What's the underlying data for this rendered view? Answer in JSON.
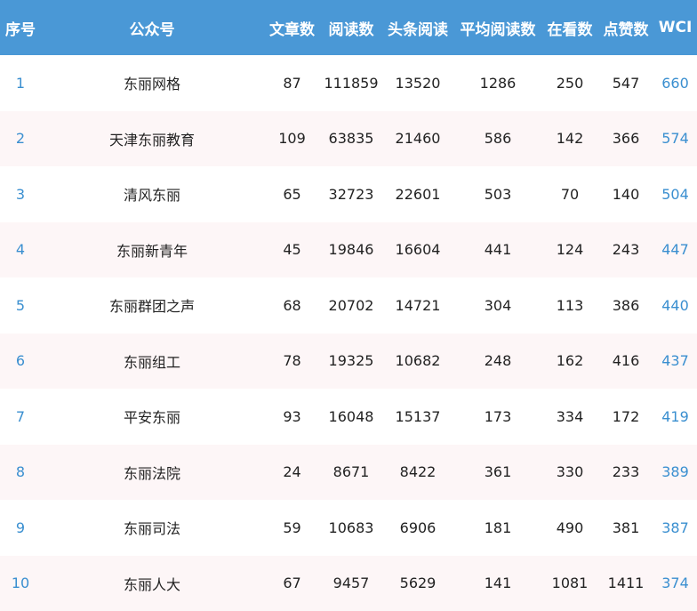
{
  "header": {
    "idx": "序号",
    "name": "公众号",
    "articles": "文章数",
    "reads": "阅读数",
    "headline_reads": "头条阅读",
    "avg_reads": "平均阅读数",
    "watching": "在看数",
    "likes": "点赞数",
    "wci": "WCI"
  },
  "rows": [
    {
      "idx": "1",
      "name": "东丽网格",
      "articles": "87",
      "reads": "111859",
      "headline_reads": "13520",
      "avg_reads": "1286",
      "watching": "250",
      "likes": "547",
      "wci": "660"
    },
    {
      "idx": "2",
      "name": "天津东丽教育",
      "articles": "109",
      "reads": "63835",
      "headline_reads": "21460",
      "avg_reads": "586",
      "watching": "142",
      "likes": "366",
      "wci": "574"
    },
    {
      "idx": "3",
      "name": "清风东丽",
      "articles": "65",
      "reads": "32723",
      "headline_reads": "22601",
      "avg_reads": "503",
      "watching": "70",
      "likes": "140",
      "wci": "504"
    },
    {
      "idx": "4",
      "name": "东丽新青年",
      "articles": "45",
      "reads": "19846",
      "headline_reads": "16604",
      "avg_reads": "441",
      "watching": "124",
      "likes": "243",
      "wci": "447"
    },
    {
      "idx": "5",
      "name": "东丽群团之声",
      "articles": "68",
      "reads": "20702",
      "headline_reads": "14721",
      "avg_reads": "304",
      "watching": "113",
      "likes": "386",
      "wci": "440"
    },
    {
      "idx": "6",
      "name": "东丽组工",
      "articles": "78",
      "reads": "19325",
      "headline_reads": "10682",
      "avg_reads": "248",
      "watching": "162",
      "likes": "416",
      "wci": "437"
    },
    {
      "idx": "7",
      "name": "平安东丽",
      "articles": "93",
      "reads": "16048",
      "headline_reads": "15137",
      "avg_reads": "173",
      "watching": "334",
      "likes": "172",
      "wci": "419"
    },
    {
      "idx": "8",
      "name": "东丽法院",
      "articles": "24",
      "reads": "8671",
      "headline_reads": "8422",
      "avg_reads": "361",
      "watching": "330",
      "likes": "233",
      "wci": "389"
    },
    {
      "idx": "9",
      "name": "东丽司法",
      "articles": "59",
      "reads": "10683",
      "headline_reads": "6906",
      "avg_reads": "181",
      "watching": "490",
      "likes": "381",
      "wci": "387"
    },
    {
      "idx": "10",
      "name": "东丽人大",
      "articles": "67",
      "reads": "9457",
      "headline_reads": "5629",
      "avg_reads": "141",
      "watching": "1081",
      "likes": "1411",
      "wci": "374"
    }
  ],
  "colors": {
    "header_bg": "#4a98d6",
    "index_text": "#3a8fd0",
    "alt_row_bg": "#fdf6f7"
  }
}
